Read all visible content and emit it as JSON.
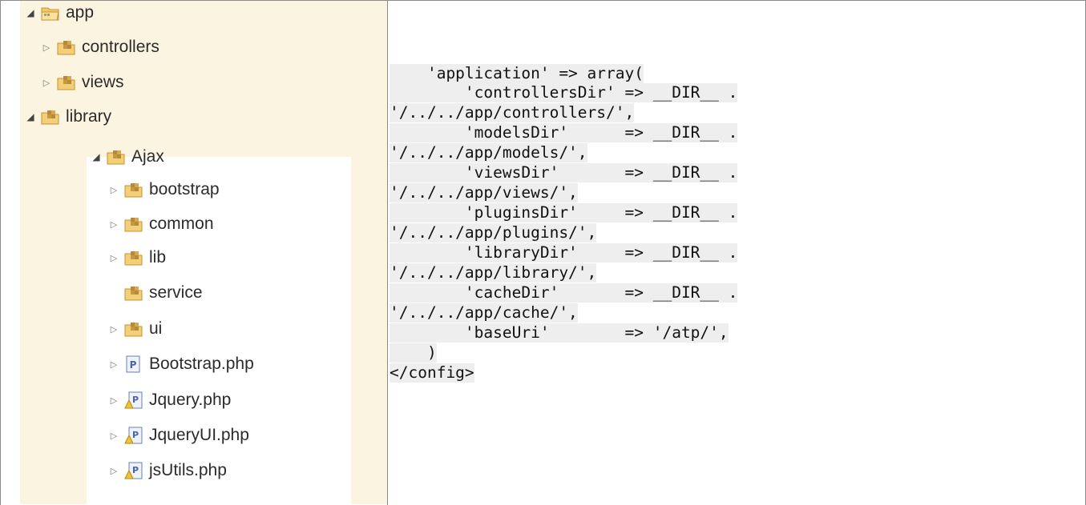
{
  "tree": {
    "items": [
      {
        "label": "app",
        "arrow": "◢",
        "icon": "package-folder-icon"
      },
      {
        "label": "controllers",
        "arrow": "▷",
        "icon": "package-icon"
      },
      {
        "label": "views",
        "arrow": "▷",
        "icon": "package-icon"
      },
      {
        "label": "library",
        "arrow": "◢",
        "icon": "package-icon"
      },
      {
        "label": "Ajax",
        "arrow": "◢",
        "icon": "package-icon"
      },
      {
        "label": "bootstrap",
        "arrow": "▷",
        "icon": "package-icon"
      },
      {
        "label": "common",
        "arrow": "▷",
        "icon": "package-icon"
      },
      {
        "label": "lib",
        "arrow": "▷",
        "icon": "package-icon"
      },
      {
        "label": "service",
        "arrow": "",
        "icon": "package-icon"
      },
      {
        "label": "ui",
        "arrow": "▷",
        "icon": "package-icon"
      },
      {
        "label": "Bootstrap.php",
        "arrow": "▷",
        "icon": "php-file-icon"
      },
      {
        "label": "Jquery.php",
        "arrow": "▷",
        "icon": "php-file-warning-icon"
      },
      {
        "label": "JqueryUI.php",
        "arrow": "▷",
        "icon": "php-file-warning-icon"
      },
      {
        "label": "jsUtils.php",
        "arrow": "▷",
        "icon": "php-file-warning-icon"
      }
    ]
  },
  "code": {
    "lines": [
      "    'application' => array(",
      "        'controllersDir' => __DIR__ .",
      "'/../../app/controllers/',",
      "        'modelsDir'      => __DIR__ .",
      "'/../../app/models/',",
      "        'viewsDir'       => __DIR__ .",
      "'/../../app/views/',",
      "        'pluginsDir'     => __DIR__ .",
      "'/../../app/plugins/',",
      "        'libraryDir'     => __DIR__ .",
      "'/../../app/library/',",
      "        'cacheDir'       => __DIR__ .",
      "'/../../app/cache/',",
      "        'baseUri'        => '/atp/',",
      "    )",
      "</config>"
    ]
  },
  "colors": {
    "tree_background": "#fbf4e0",
    "code_background": "#eeeeee",
    "border": "#8a8a8a"
  }
}
